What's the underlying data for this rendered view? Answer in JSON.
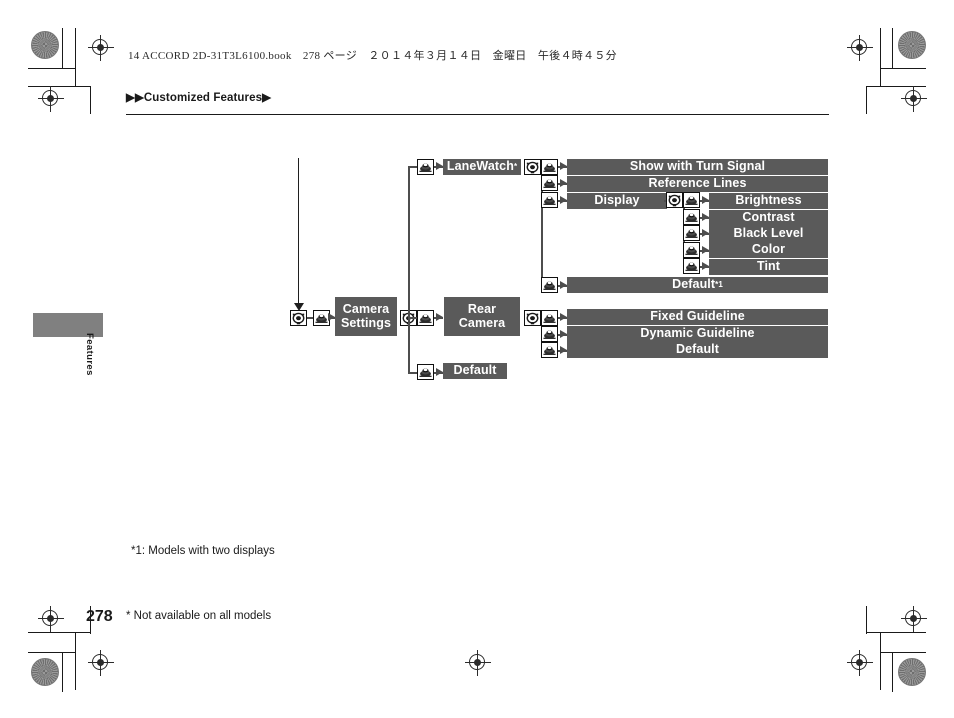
{
  "page": {
    "book_header": "14 ACCORD 2D-31T3L6100.book　278 ページ　２０１４年３月１４日　金曜日　午後４時４５分",
    "breadcrumb": "▶▶Customized Features▶",
    "side_tab_label": "Features",
    "page_number": "278",
    "page_note": "* Not available on all models",
    "footnote": "*1: Models with two displays"
  },
  "colors": {
    "bar_fill": "#5a5a5a",
    "bar_text": "#ffffff",
    "line": "#4d4d4d",
    "tab_fill": "#808080",
    "text": "#1a1a1a"
  },
  "icons": {
    "knob": "selector-knob-icon",
    "enter": "enter-button-icon"
  },
  "diagram": {
    "type": "menu-tree",
    "root": {
      "label": "Camera Settings",
      "line1": "Camera",
      "line2": "Settings"
    },
    "branches": [
      {
        "label": "LaneWatch*",
        "text": "LaneWatch",
        "footnote_mark": "*",
        "children": [
          {
            "label": "Show with Turn Signal"
          },
          {
            "label": "Reference Lines"
          },
          {
            "label": "Display",
            "children": [
              {
                "label": "Brightness"
              },
              {
                "label": "Contrast"
              },
              {
                "label": "Black Level"
              },
              {
                "label": "Color"
              },
              {
                "label": "Tint"
              }
            ]
          },
          {
            "label": "Default*1",
            "text": "Default",
            "footnote_mark": "*1"
          }
        ]
      },
      {
        "label": "Rear Camera",
        "line1": "Rear",
        "line2": "Camera",
        "children": [
          {
            "label": "Fixed Guideline"
          },
          {
            "label": "Dynamic Guideline"
          },
          {
            "label": "Default"
          }
        ]
      },
      {
        "label": "Default",
        "text": "Default",
        "children": []
      }
    ]
  }
}
